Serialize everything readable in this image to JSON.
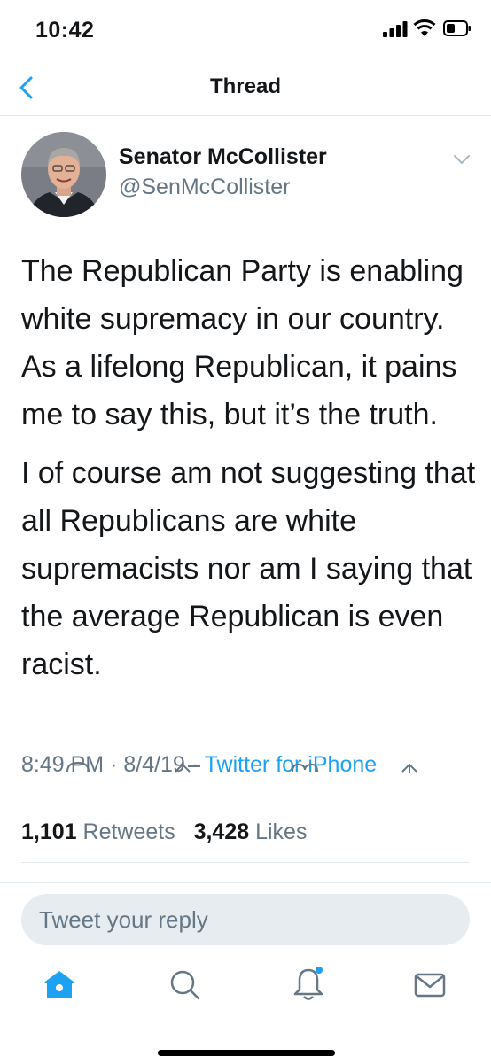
{
  "status_bar": {
    "time": "10:42"
  },
  "nav": {
    "title": "Thread"
  },
  "tweet": {
    "display_name": "Senator McCollister",
    "handle": "@SenMcCollister",
    "paragraphs": [
      "The Republican Party is enabling white supremacy in our country.  As a lifelong Republican, it pains me to say this, but it’s the truth.",
      "I of course am not suggesting that all Republicans are white supremacists nor am I saying that the average Republican is even racist."
    ],
    "time": "8:49 PM",
    "date": "8/4/19",
    "separator": "·",
    "source": "Twitter for iPhone",
    "retweets_count": "1,101",
    "retweets_label": "Retweets",
    "likes_count": "3,428",
    "likes_label": "Likes"
  },
  "reply": {
    "placeholder": "Tweet your reply"
  },
  "tab_bar": {
    "items": [
      "home-icon",
      "search-icon",
      "notifications-icon",
      "messages-icon"
    ],
    "active": "home-icon",
    "notification_dot": true
  },
  "colors": {
    "accent": "#1da1f2",
    "secondary_text": "#657786",
    "primary_text": "#14171a",
    "divider": "#e1e8ed"
  }
}
